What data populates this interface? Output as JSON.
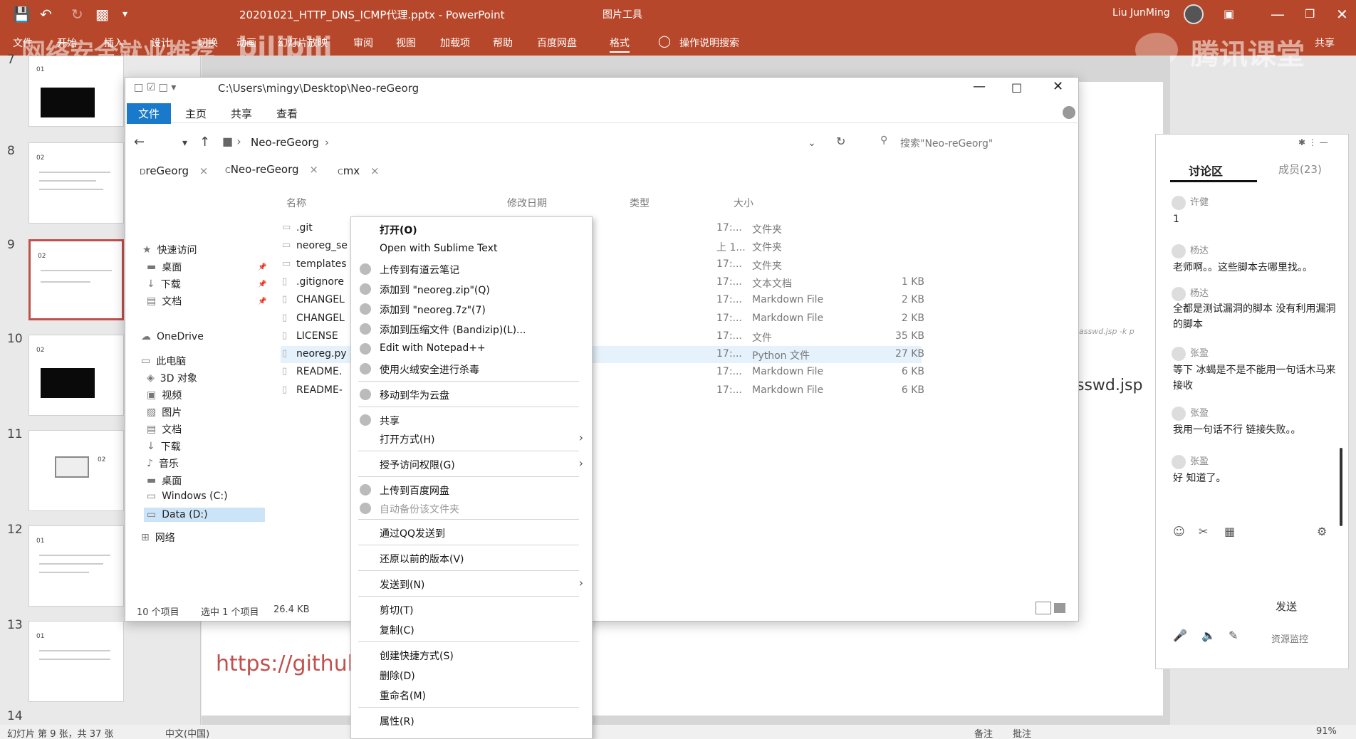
{
  "ppt": {
    "doc_title": "20201021_HTTP_DNS_ICMP代理.pptx - PowerPoint",
    "context_tab": "图片工具",
    "user": "Liu JunMing",
    "share": "共享",
    "tabs": [
      "文件",
      "开始",
      "插入",
      "设计",
      "切换",
      "动画",
      "幻灯片放映",
      "审阅",
      "视图",
      "加载项",
      "帮助",
      "百度网盘",
      "格式"
    ],
    "tell_me": "操作说明搜索",
    "watermark_left": "网络安全就业推荐",
    "watermark_bili": "bilibili",
    "watermark_right": "腾讯课堂",
    "slide_numbers": [
      "7",
      "8",
      "9",
      "10",
      "11",
      "12",
      "13",
      "14"
    ],
    "thumb_labels": [
      "01",
      "02",
      "02",
      "02",
      "02",
      "01",
      "01"
    ],
    "slide_url": "https://github.c",
    "slide_side_text": "sswd.jsp",
    "slide_side_small": "asswd.jsp -k p",
    "status": {
      "slide": "幻灯片 第 9 张，共 37 张",
      "lang": "中文(中国)",
      "notes": "备注",
      "comments": "批注",
      "zoom": "91%"
    }
  },
  "explorer": {
    "path": "C:\\Users\\mingy\\Desktop\\Neo-reGeorg",
    "ribbon_tabs": [
      "文件",
      "主页",
      "共享",
      "查看"
    ],
    "breadcrumb": "Neo-reGeorg",
    "search_placeholder": "搜索\"Neo-reGeorg\"",
    "quick_tabs": [
      "reGeorg",
      "Neo-reGeorg",
      "mx"
    ],
    "quick_tab_letters": [
      "D",
      "C",
      "C"
    ],
    "columns": [
      "名称",
      "修改日期",
      "类型",
      "大小"
    ],
    "nav": [
      {
        "label": "快速访问",
        "icon": "star-icon"
      },
      {
        "label": "桌面",
        "icon": "desktop-icon"
      },
      {
        "label": "下载",
        "icon": "download-icon"
      },
      {
        "label": "文档",
        "icon": "document-icon"
      },
      {
        "label": "OneDrive",
        "icon": "cloud-icon"
      },
      {
        "label": "此电脑",
        "icon": "computer-icon"
      },
      {
        "label": "3D 对象",
        "icon": "cube-icon"
      },
      {
        "label": "视频",
        "icon": "video-icon"
      },
      {
        "label": "图片",
        "icon": "picture-icon"
      },
      {
        "label": "文档",
        "icon": "document-icon"
      },
      {
        "label": "下载",
        "icon": "download-icon"
      },
      {
        "label": "音乐",
        "icon": "music-icon"
      },
      {
        "label": "桌面",
        "icon": "desktop-icon"
      },
      {
        "label": "Windows (C:)",
        "icon": "drive-icon"
      },
      {
        "label": "Data (D:)",
        "icon": "drive-icon"
      },
      {
        "label": "网络",
        "icon": "network-icon"
      }
    ],
    "files": [
      {
        "name": ".git",
        "date": "17:...",
        "type": "文件夹",
        "size": ""
      },
      {
        "name": "neoreg_se",
        "date": "上 1...",
        "type": "文件夹",
        "size": ""
      },
      {
        "name": "templates",
        "date": "17:...",
        "type": "文件夹",
        "size": ""
      },
      {
        "name": ".gitignore",
        "date": "17:...",
        "type": "文本文档",
        "size": "1 KB"
      },
      {
        "name": "CHANGEL",
        "date": "17:...",
        "type": "Markdown File",
        "size": "2 KB"
      },
      {
        "name": "CHANGEL",
        "date": "17:...",
        "type": "Markdown File",
        "size": "2 KB"
      },
      {
        "name": "LICENSE",
        "date": "17:...",
        "type": "文件",
        "size": "35 KB"
      },
      {
        "name": "neoreg.py",
        "date": "17:...",
        "type": "Python 文件",
        "size": "27 KB"
      },
      {
        "name": "README.",
        "date": "17:...",
        "type": "Markdown File",
        "size": "6 KB"
      },
      {
        "name": "README-",
        "date": "17:...",
        "type": "Markdown File",
        "size": "6 KB"
      }
    ],
    "status": {
      "count": "10 个项目",
      "selected": "选中 1 个项目",
      "size": "26.4 KB"
    }
  },
  "context_menu": {
    "items": [
      {
        "label": "打开(O)",
        "bold": true
      },
      {
        "label": "Open with Sublime Text"
      },
      {
        "label": "上传到有道云笔记"
      },
      {
        "label": "添加到 \"neoreg.zip\"(Q)"
      },
      {
        "label": "添加到 \"neoreg.7z\"(7)"
      },
      {
        "label": "添加到压缩文件 (Bandizip)(L)..."
      },
      {
        "label": "Edit with Notepad++"
      },
      {
        "label": "使用火绒安全进行杀毒"
      },
      {
        "label": "移动到华为云盘"
      },
      {
        "label": "共享"
      },
      {
        "label": "打开方式(H)",
        "sub": true
      },
      {
        "label": "授予访问权限(G)",
        "sub": true
      },
      {
        "label": "上传到百度网盘"
      },
      {
        "label": "自动备份该文件夹",
        "dim": true
      },
      {
        "label": "通过QQ发送到"
      },
      {
        "label": "还原以前的版本(V)"
      },
      {
        "label": "发送到(N)",
        "sub": true
      },
      {
        "label": "剪切(T)"
      },
      {
        "label": "复制(C)"
      },
      {
        "label": "创建快捷方式(S)"
      },
      {
        "label": "删除(D)"
      },
      {
        "label": "重命名(M)"
      },
      {
        "label": "属性(R)"
      }
    ]
  },
  "chat": {
    "tab_discussion": "讨论区",
    "tab_members": "成员(23)",
    "messages": [
      {
        "user": "许健",
        "text": "1"
      },
      {
        "user": "杨达",
        "text": "老师啊。。这些脚本去哪里找。。"
      },
      {
        "user": "杨达",
        "text": "全都是测试漏洞的脚本 没有利用漏洞的脚本"
      },
      {
        "user": "张盈",
        "text": "等下 冰蝎是不是不能用一句话木马来接收"
      },
      {
        "user": "张盈",
        "text": "我用一句话不行 链接失败。。"
      },
      {
        "user": "张盈",
        "text": "好 知道了。"
      }
    ],
    "send": "发送",
    "monitor": "资源监控"
  }
}
